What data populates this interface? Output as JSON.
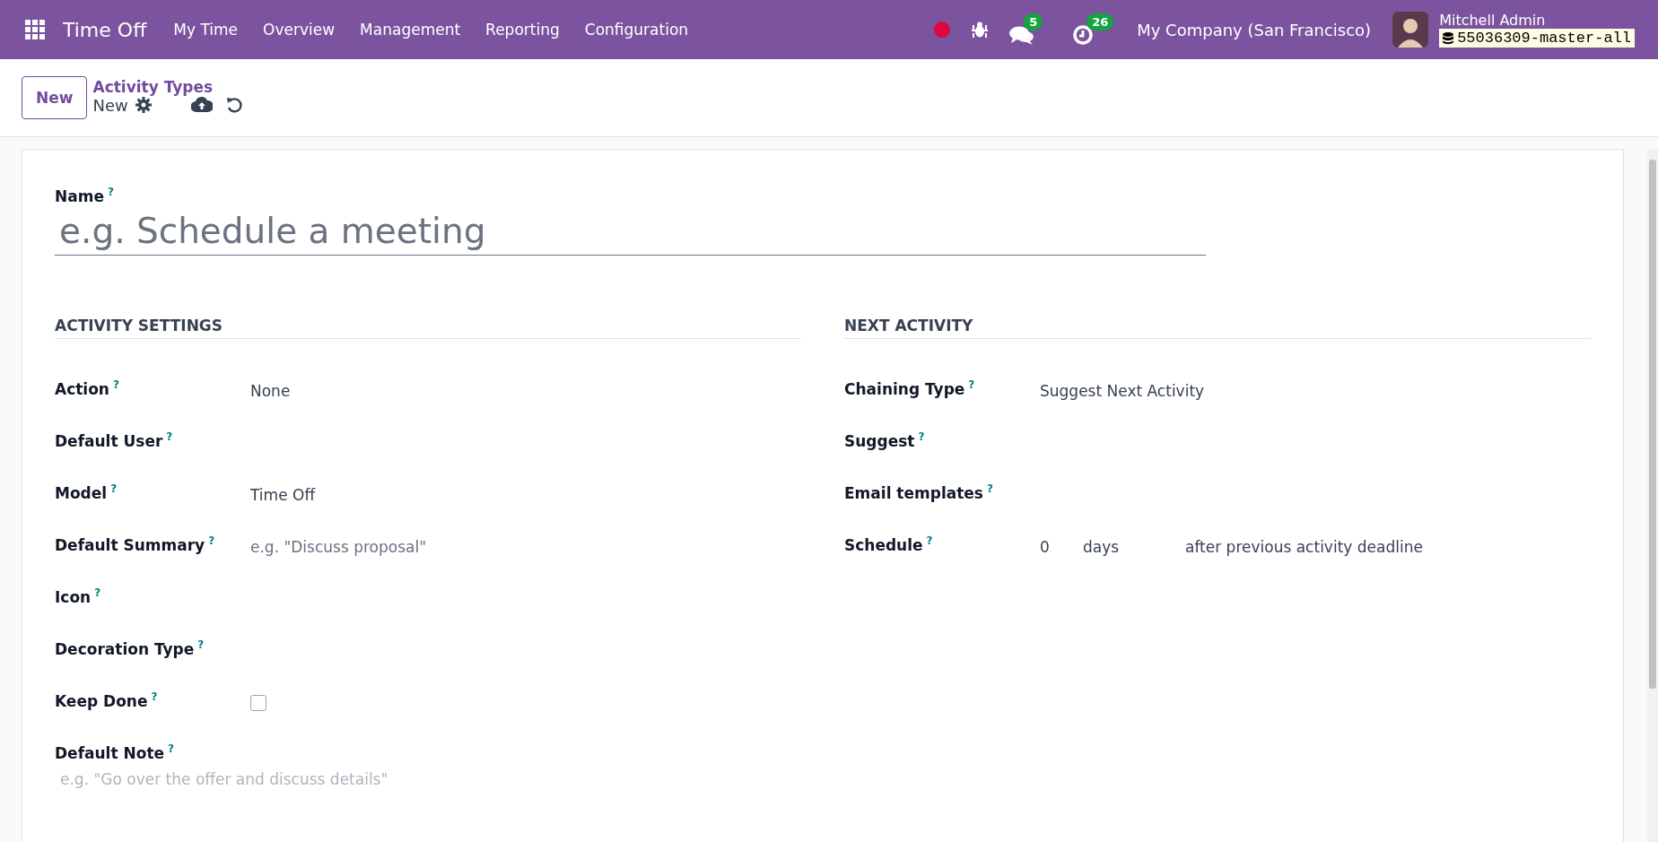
{
  "navbar": {
    "app": "Time Off",
    "menu": [
      "My Time",
      "Overview",
      "Management",
      "Reporting",
      "Configuration"
    ],
    "messages_badge": "5",
    "activities_badge": "26",
    "company": "My Company (San Francisco)",
    "user": "Mitchell Admin",
    "database": "55036309-master-all"
  },
  "control_panel": {
    "new_button": "New",
    "breadcrumb": "Activity Types",
    "record": "New"
  },
  "form": {
    "name_label": "Name",
    "name_help": "?",
    "name_placeholder": "e.g. Schedule a meeting",
    "sections": [
      {
        "title": "ACTIVITY SETTINGS",
        "fields": [
          {
            "label": "Action",
            "help": "?",
            "kind": "select",
            "value": "None"
          },
          {
            "label": "Default User",
            "help": "?",
            "kind": "input"
          },
          {
            "label": "Model",
            "help": "?",
            "kind": "select",
            "value": "Time Off"
          },
          {
            "label": "Default Summary",
            "help": "?",
            "kind": "input",
            "placeholder": "e.g. \"Discuss proposal\""
          },
          {
            "label": "Icon",
            "help": "?",
            "kind": "input"
          },
          {
            "label": "Decoration Type",
            "help": "?",
            "kind": "input"
          },
          {
            "label": "Keep Done",
            "help": "?",
            "kind": "checkbox",
            "checked": false
          },
          {
            "label": "Default Note",
            "help": "?",
            "kind": "note",
            "placeholder": "e.g. \"Go over the offer and discuss details\""
          }
        ]
      },
      {
        "title": "NEXT ACTIVITY",
        "fields": [
          {
            "label": "Chaining Type",
            "help": "?",
            "kind": "select",
            "value": "Suggest Next Activity"
          },
          {
            "label": "Suggest",
            "help": "?",
            "kind": "input"
          },
          {
            "label": "Email templates",
            "help": "?",
            "kind": "input"
          },
          {
            "label": "Schedule",
            "help": "?",
            "kind": "schedule",
            "value": "0",
            "unit": "days",
            "relation": "after previous activity deadline"
          }
        ]
      }
    ]
  }
}
